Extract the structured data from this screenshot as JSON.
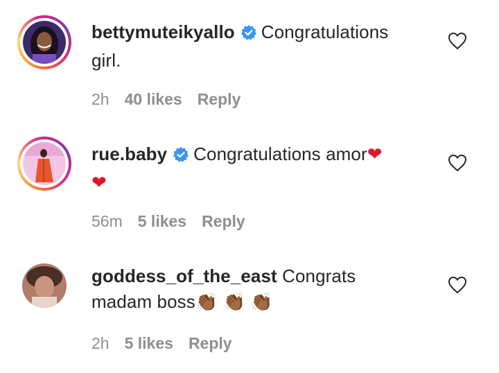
{
  "comments": [
    {
      "username": "bettymuteikyallo",
      "verified": true,
      "text_line1": "Congratulations",
      "text_line2": "girl.",
      "time": "2h",
      "likes": "40 likes",
      "reply_label": "Reply",
      "story_ring": true,
      "avatar_icon": "avatar-photo"
    },
    {
      "username": "rue.baby",
      "verified": true,
      "text_line1": "Congratulations amor",
      "emoji1": "❤",
      "emoji2": "❤",
      "time": "56m",
      "likes": "5 likes",
      "reply_label": "Reply",
      "story_ring": true,
      "avatar_icon": "avatar-photo"
    },
    {
      "username": "goddess_of_the_east",
      "verified": false,
      "text_line1": "Congrats",
      "text_line2": "madam boss",
      "emojis": "👏🏾 👏🏾 👏🏾",
      "time": "2h",
      "likes": "5 likes",
      "reply_label": "Reply",
      "story_ring": false,
      "avatar_icon": "avatar-photo"
    }
  ],
  "colors": {
    "verified_blue": "#3897f0",
    "meta_gray": "#8e8e8e",
    "heart_red": "#e0162b"
  }
}
